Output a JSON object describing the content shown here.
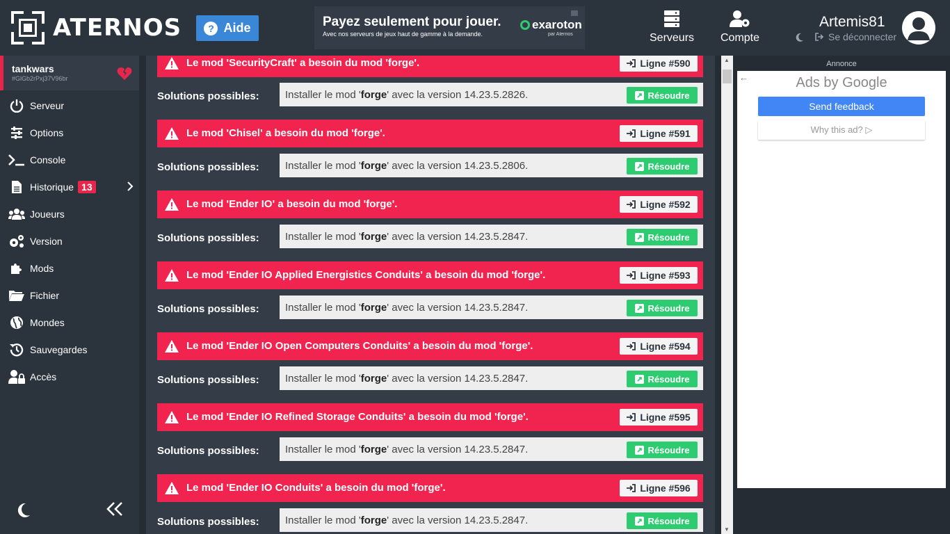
{
  "header": {
    "logo_text": "ATERNOS",
    "help_label": "Aide",
    "promo": {
      "title": "Payez seulement pour jouer.",
      "subtitle": "Avec nos serveurs de jeux haut de gamme à la demande.",
      "brand": "exaroton",
      "brand_sub": "par Aternos"
    },
    "nav": {
      "servers_label": "Serveurs",
      "account_label": "Compte"
    },
    "user": {
      "name": "Artemis81",
      "logout_label": "Se déconnecter"
    }
  },
  "sidebar": {
    "server": {
      "name": "tankwars",
      "id": "#GlGb2rPxj37V96br"
    },
    "items": [
      {
        "label": "Serveur",
        "icon": "power-icon"
      },
      {
        "label": "Options",
        "icon": "sliders-icon"
      },
      {
        "label": "Console",
        "icon": "terminal-icon"
      },
      {
        "label": "Historique",
        "icon": "file-icon",
        "badge": "13"
      },
      {
        "label": "Joueurs",
        "icon": "users-icon"
      },
      {
        "label": "Version",
        "icon": "gears-icon"
      },
      {
        "label": "Mods",
        "icon": "puzzle-icon"
      },
      {
        "label": "Fichier",
        "icon": "folder-icon"
      },
      {
        "label": "Mondes",
        "icon": "globe-icon"
      },
      {
        "label": "Sauvegardes",
        "icon": "history-icon"
      },
      {
        "label": "Accès",
        "icon": "user-lock-icon"
      }
    ]
  },
  "main": {
    "solutions_label": "Solutions possibles:",
    "resolve_label": "Résoudre",
    "errors": [
      {
        "message": "Le mod 'SecurityCraft' a besoin du mod 'forge'.",
        "line": "Ligne #590",
        "solution_prefix": "Installer le mod '",
        "solution_mod": "forge",
        "solution_suffix": "' avec la version 14.23.5.2826."
      },
      {
        "message": "Le mod 'Chisel' a besoin du mod 'forge'.",
        "line": "Ligne #591",
        "solution_prefix": "Installer le mod '",
        "solution_mod": "forge",
        "solution_suffix": "' avec la version 14.23.5.2806."
      },
      {
        "message": "Le mod 'Ender IO' a besoin du mod 'forge'.",
        "line": "Ligne #592",
        "solution_prefix": "Installer le mod '",
        "solution_mod": "forge",
        "solution_suffix": "' avec la version 14.23.5.2847."
      },
      {
        "message": "Le mod 'Ender IO Applied Energistics Conduits' a besoin du mod 'forge'.",
        "line": "Ligne #593",
        "solution_prefix": "Installer le mod '",
        "solution_mod": "forge",
        "solution_suffix": "' avec la version 14.23.5.2847."
      },
      {
        "message": "Le mod 'Ender IO Open Computers Conduits' a besoin du mod 'forge'.",
        "line": "Ligne #594",
        "solution_prefix": "Installer le mod '",
        "solution_mod": "forge",
        "solution_suffix": "' avec la version 14.23.5.2847."
      },
      {
        "message": "Le mod 'Ender IO Refined Storage Conduits' a besoin du mod 'forge'.",
        "line": "Ligne #595",
        "solution_prefix": "Installer le mod '",
        "solution_mod": "forge",
        "solution_suffix": "' avec la version 14.23.5.2847."
      },
      {
        "message": "Le mod 'Ender IO Conduits' a besoin du mod 'forge'.",
        "line": "Ligne #596",
        "solution_prefix": "Installer le mod '",
        "solution_mod": "forge",
        "solution_suffix": "' avec la version 14.23.5.2847."
      }
    ]
  },
  "ad": {
    "label": "Annonce",
    "by_text": "Ads by Google",
    "feedback_label": "Send feedback",
    "why_label": "Why this ad? ▷"
  },
  "colors": {
    "accent_red": "#f0244f",
    "accent_green": "#2ecc71",
    "accent_blue": "#3987d6"
  }
}
